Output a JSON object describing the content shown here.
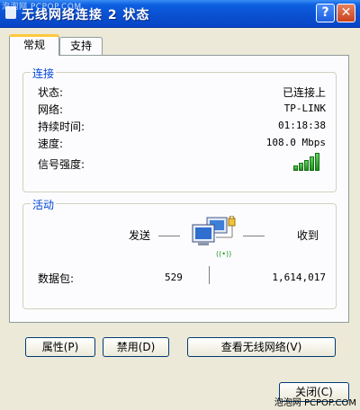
{
  "window": {
    "title": "无线网络连接 2 状态",
    "watermark_top": "泡泡网 PCPOP.COM",
    "help_label": "?",
    "close_label": "✕"
  },
  "tabs": [
    {
      "label": "常规",
      "active": true
    },
    {
      "label": "支持",
      "active": false
    }
  ],
  "connection": {
    "legend": "连接",
    "rows": [
      {
        "label": "状态:",
        "value": "已连接上"
      },
      {
        "label": "网络:",
        "value": "TP-LINK"
      },
      {
        "label": "持续时间:",
        "value": "01:18:38"
      },
      {
        "label": "速度:",
        "value": "108.0 Mbps"
      }
    ],
    "signal_label": "信号强度:",
    "signal_bars": 5,
    "signal_level": 1.0,
    "signal_color": "#2ea52e"
  },
  "activity": {
    "legend": "活动",
    "sent_label": "发送",
    "received_label": "收到",
    "packets_label": "数据包:",
    "packets_sent": "529",
    "packets_received": "1,614,017"
  },
  "buttons": {
    "properties": "属性(P)",
    "disable": "禁用(D)",
    "view_networks": "查看无线网络(V)",
    "close": "关闭(C)"
  },
  "watermark_bottom": "泡泡网 PCPOP.COM"
}
